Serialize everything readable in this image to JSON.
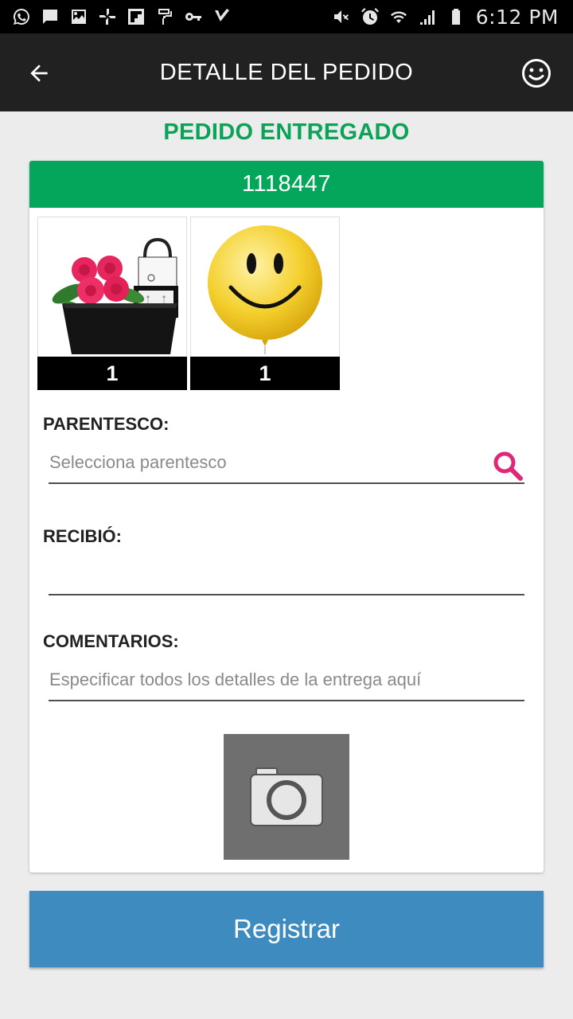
{
  "status_bar": {
    "time": "6:12 PM",
    "left_icons": [
      "whatsapp-icon",
      "message-icon",
      "image-icon",
      "pinwheel-icon",
      "flipboard-icon",
      "paint-roller-icon",
      "key-icon",
      "checkmark-icon"
    ],
    "right_icons": [
      "mute-icon",
      "alarm-icon",
      "wifi-icon",
      "signal-icon",
      "battery-icon"
    ]
  },
  "app_bar": {
    "title": "DETALLE DEL PEDIDO",
    "back_icon": "arrow-back-icon",
    "action_icon": "smiley-icon"
  },
  "order": {
    "status": "PEDIDO ENTREGADO",
    "number": "1118447",
    "status_color": "#0aa357",
    "header_color": "#03a65a",
    "products": [
      {
        "image": "roses-gift-box-image",
        "quantity": "1"
      },
      {
        "image": "smiley-balloon-image",
        "quantity": "1"
      }
    ]
  },
  "form": {
    "parentesco_label": "PARENTESCO:",
    "parentesco_placeholder": "Selecciona parentesco",
    "recibio_label": "RECIBIÓ:",
    "recibio_value": "",
    "comentarios_label": "COMENTARIOS:",
    "comentarios_placeholder": "Especificar todos los detalles de la entrega aquí",
    "search_icon": "search-icon",
    "search_icon_color": "#e0287a",
    "camera_icon": "camera-icon"
  },
  "actions": {
    "register_label": "Registrar",
    "register_color": "#3e8bbf"
  }
}
